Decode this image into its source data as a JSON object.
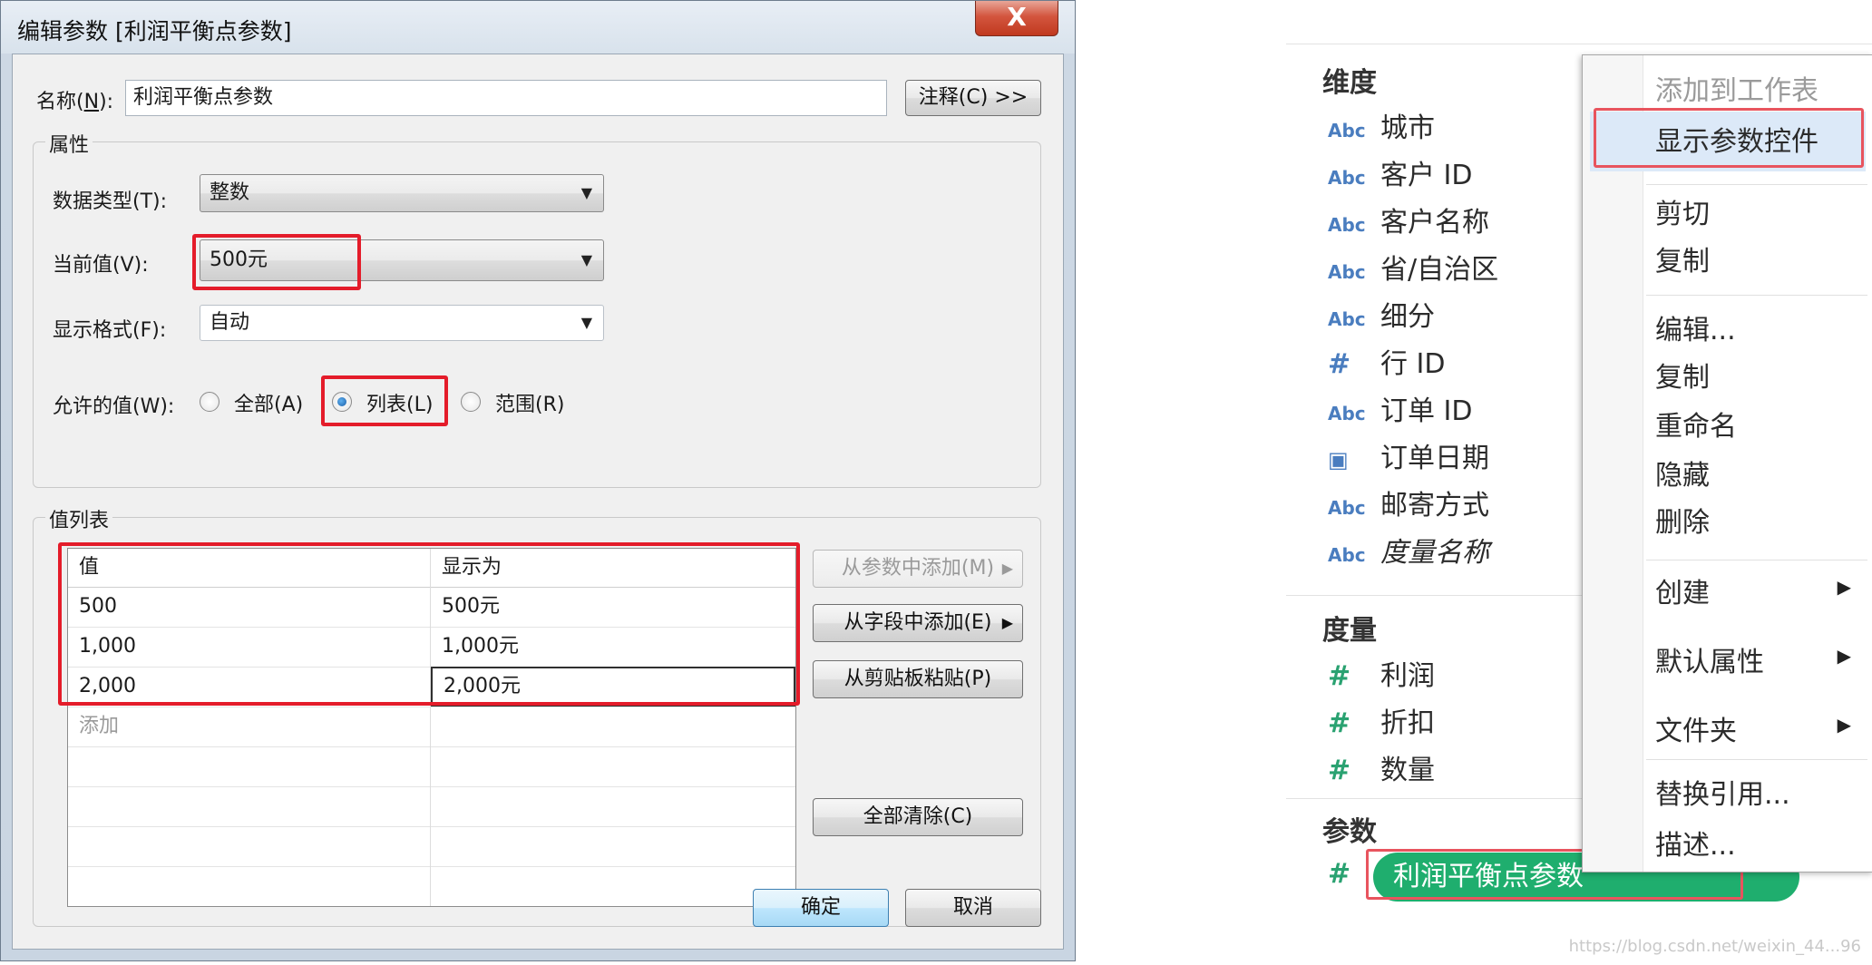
{
  "dialog": {
    "title": "编辑参数 [利润平衡点参数]",
    "close_glyph": "X",
    "name_label": "名称(",
    "name_hotkey": "N",
    "name_label_end": "):",
    "name_value": "利润平衡点参数",
    "comment_button": "注释(C) >>",
    "properties_title": "属性",
    "datatype_label": "数据类型(T):",
    "datatype_value": "整数",
    "current_label": "当前值(V):",
    "current_value": "500元",
    "format_label": "显示格式(F):",
    "format_value": "自动",
    "allowed_label": "允许的值(W):",
    "allowed_options": [
      "全部(A)",
      "列表(L)",
      "范围(R)"
    ],
    "allowed_selected": "列表(L)",
    "values_title": "值列表",
    "table_headers": [
      "值",
      "显示为"
    ],
    "table_rows": [
      [
        "500",
        "500元"
      ],
      [
        "1,000",
        "1,000元"
      ],
      [
        "2,000",
        "2,000元"
      ]
    ],
    "add_placeholder": "添加",
    "side_buttons": [
      "从参数中添加(M)",
      "从字段中添加(E)",
      "从剪贴板粘贴(P)",
      "全部清除(C)"
    ],
    "ok": "确定",
    "cancel": "取消"
  },
  "panel": {
    "dimensions_title": "维度",
    "dimensions": [
      {
        "icon": "Abc",
        "name": "城市"
      },
      {
        "icon": "Abc",
        "name": "客户 ID"
      },
      {
        "icon": "Abc",
        "name": "客户名称"
      },
      {
        "icon": "Abc",
        "name": "省/自治区"
      },
      {
        "icon": "Abc",
        "name": "细分"
      },
      {
        "icon": "#",
        "name": "行 ID"
      },
      {
        "icon": "Abc",
        "name": "订单 ID"
      },
      {
        "icon": "▣",
        "name": "订单日期"
      },
      {
        "icon": "Abc",
        "name": "邮寄方式"
      },
      {
        "icon": "Abc",
        "name": "度量名称"
      }
    ],
    "measures_title": "度量",
    "measures": [
      {
        "icon": "#",
        "name": "利润"
      },
      {
        "icon": "#",
        "name": "折扣"
      },
      {
        "icon": "#",
        "name": "数量"
      }
    ],
    "params_title": "参数",
    "param_icon": "#",
    "param_name": "利润平衡点参数",
    "watermark": "https://blog.csdn.net/weixin_44...96"
  },
  "menu": {
    "items": [
      {
        "label": "添加到工作表",
        "disabled": true
      },
      {
        "label": "显示参数控件",
        "highlight": true
      },
      {
        "label": "剪切"
      },
      {
        "label": "复制"
      },
      {
        "label": "编辑..."
      },
      {
        "label": "复制"
      },
      {
        "label": "重命名"
      },
      {
        "label": "隐藏"
      },
      {
        "label": "删除"
      },
      {
        "label": "创建",
        "submenu": true
      },
      {
        "label": "默认属性",
        "submenu": true
      },
      {
        "label": "文件夹",
        "submenu": true
      },
      {
        "label": "替换引用..."
      },
      {
        "label": "描述..."
      }
    ],
    "arrow_glyph": "▶"
  }
}
